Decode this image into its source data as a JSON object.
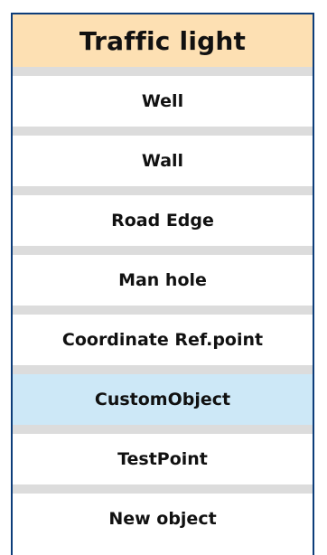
{
  "list": {
    "header": "Traffic light",
    "items": [
      {
        "label": "Well",
        "selected": false
      },
      {
        "label": "Wall",
        "selected": false
      },
      {
        "label": "Road Edge",
        "selected": false
      },
      {
        "label": "Man hole",
        "selected": false
      },
      {
        "label": "Coordinate Ref.point",
        "selected": false
      },
      {
        "label": "CustomObject",
        "selected": true
      },
      {
        "label": "TestPoint",
        "selected": false
      },
      {
        "label": "New object",
        "selected": false
      }
    ]
  },
  "colors": {
    "header_bg": "#fde0b3",
    "selected_bg": "#cde8f7",
    "separator": "#dcdcdc",
    "border": "#0d3d7a"
  }
}
